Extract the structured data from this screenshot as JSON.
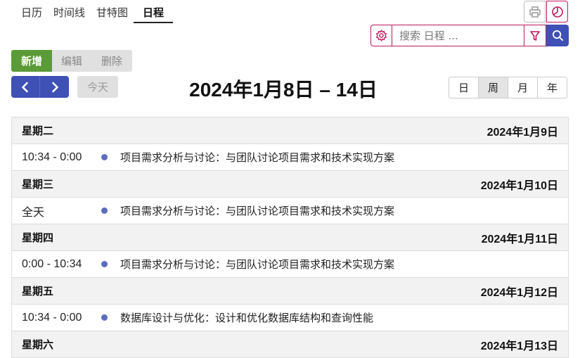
{
  "tabs": [
    "日历",
    "时间线",
    "甘特图",
    "日程"
  ],
  "search": {
    "placeholder": "搜索 日程 ..."
  },
  "actions": {
    "new": "新增",
    "edit": "编辑",
    "delete": "删除"
  },
  "nav": {
    "today": "今天",
    "range_title": "2024年1月8日 – 14日"
  },
  "views": [
    "日",
    "周",
    "月",
    "年"
  ],
  "active_view": "周",
  "colors": {
    "accent": "#3f51b5",
    "new_button": "#5a9b37",
    "pink": "#c2185b",
    "event_dot": "#5c6bc0"
  },
  "days": [
    {
      "weekday": "星期二",
      "date": "2024年1月9日",
      "event": {
        "time": "10:34 - 0:00",
        "title": "项目需求分析与讨论：与团队讨论项目需求和技术实现方案"
      }
    },
    {
      "weekday": "星期三",
      "date": "2024年1月10日",
      "event": {
        "time": "全天",
        "title": "项目需求分析与讨论：与团队讨论项目需求和技术实现方案"
      }
    },
    {
      "weekday": "星期四",
      "date": "2024年1月11日",
      "event": {
        "time": "0:00 - 10:34",
        "title": "项目需求分析与讨论：与团队讨论项目需求和技术实现方案"
      }
    },
    {
      "weekday": "星期五",
      "date": "2024年1月12日",
      "event": {
        "time": "10:34 - 0:00",
        "title": "数据库设计与优化：设计和优化数据库结构和查询性能"
      }
    },
    {
      "weekday": "星期六",
      "date": "2024年1月13日"
    }
  ]
}
